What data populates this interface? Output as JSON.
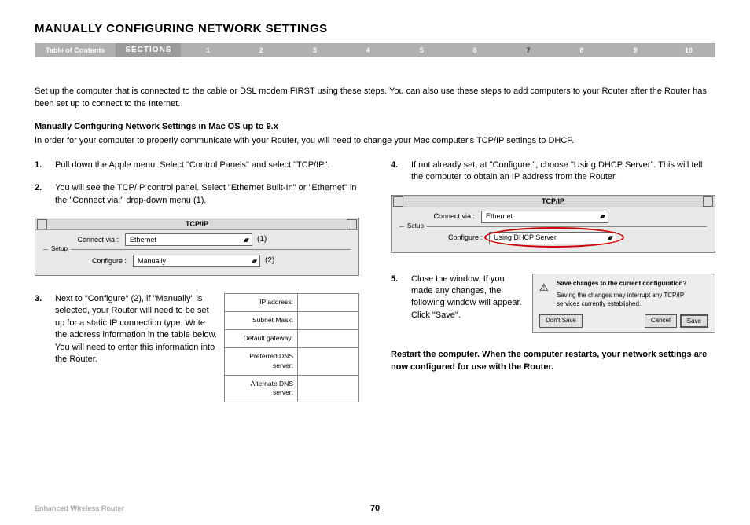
{
  "title": "MANUALLY CONFIGURING NETWORK SETTINGS",
  "bar": {
    "toc": "Table of Contents",
    "sections": "SECTIONS",
    "nums": [
      "1",
      "2",
      "3",
      "4",
      "5",
      "6",
      "7",
      "8",
      "9",
      "10"
    ],
    "active": "7"
  },
  "intro": "Set up the computer that is connected to the cable or DSL modem FIRST using these steps. You can also use these steps to add computers to your Router after the Router has been set up to connect to the Internet.",
  "subhead": "Manually Configuring Network Settings in Mac OS up to 9.x",
  "subintro": "In order for your computer to properly communicate with your Router, you will need to change your Mac computer's TCP/IP settings to DHCP.",
  "steps": {
    "s1": {
      "n": "1.",
      "t": "Pull down the Apple menu. Select \"Control Panels\" and select \"TCP/IP\"."
    },
    "s2": {
      "n": "2.",
      "t": "You will see the TCP/IP control panel. Select \"Ethernet Built-In\" or \"Ethernet\" in the \"Connect via:\" drop-down menu (1)."
    },
    "s3": {
      "n": "3.",
      "t": "Next to \"Configure\" (2), if \"Manually\" is selected, your Router will need to be set up for a static IP connection type. Write the address information in the table below. You will need to enter this information into the Router."
    },
    "s4": {
      "n": "4.",
      "t": "If not already set, at \"Configure:\", choose \"Using DHCP Server\". This will tell the computer to obtain an IP address from the Router."
    },
    "s5": {
      "n": "5.",
      "t": "Close the window. If you made any changes, the following window will appear. Click \"Save\"."
    }
  },
  "panel1": {
    "title": "TCP/IP",
    "connect_label": "Connect via :",
    "connect_value": "Ethernet",
    "setup": "Setup",
    "configure_label": "Configure :",
    "configure_value": "Manually",
    "c1": "(1)",
    "c2": "(2)"
  },
  "panel2": {
    "title": "TCP/IP",
    "connect_label": "Connect via :",
    "connect_value": "Ethernet",
    "setup": "Setup",
    "configure_label": "Configure :",
    "configure_value": "Using DHCP Server"
  },
  "table": {
    "r1": "IP address:",
    "r2": "Subnet Mask:",
    "r3": "Default gateway:",
    "r4": "Preferred DNS server:",
    "r5": "Alternate DNS server:"
  },
  "dialog": {
    "q": "Save changes to the current configuration?",
    "w": "Saving the changes may interrupt any TCP/IP services currently established.",
    "b1": "Don't Save",
    "b2": "Cancel",
    "b3": "Save"
  },
  "restart": "Restart the computer. When the computer restarts, your network settings are now configured for use with the Router.",
  "footer": {
    "product": "Enhanced Wireless Router",
    "page": "70"
  }
}
